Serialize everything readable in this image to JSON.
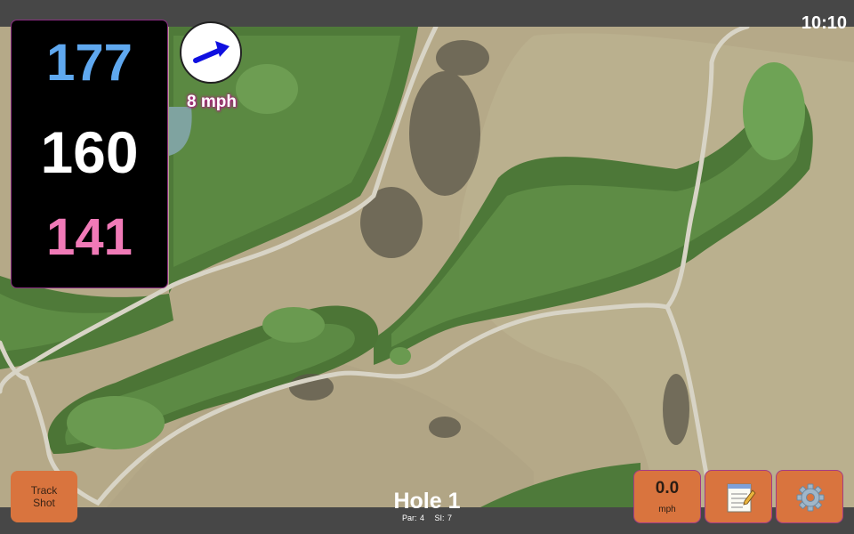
{
  "status": {
    "time": "10:10"
  },
  "distances": {
    "back": "177",
    "center": "160",
    "front": "141"
  },
  "wind": {
    "speed_label": "8 mph",
    "icon": "wind-arrow-icon"
  },
  "buttons": {
    "track_shot_line1": "Track",
    "track_shot_line2": "Shot",
    "speed_value": "0.0",
    "speed_unit": "mph",
    "notes_icon": "notepad-icon",
    "settings_icon": "gear-icon"
  },
  "hole": {
    "title": "Hole 1",
    "par": "Par: 4",
    "si": "SI: 7"
  },
  "colors": {
    "back_distance": "#5fa8ef",
    "center_distance": "#ffffff",
    "front_distance": "#f07ab7",
    "button": "#d9743e",
    "wind_arrow": "#1010e0",
    "accent_border": "#a43c84"
  }
}
